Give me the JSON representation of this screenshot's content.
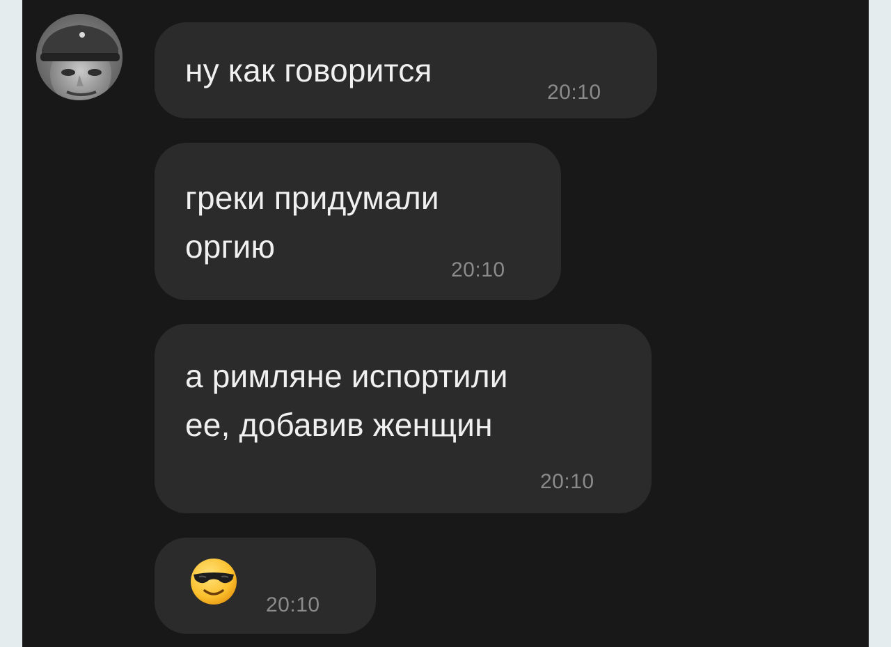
{
  "chat": {
    "messages": [
      {
        "text": "ну как говорится",
        "time": "20:10"
      },
      {
        "text": "греки придумали\nоргию",
        "time": "20:10"
      },
      {
        "text": "а римляне испортили\nее, добавив женщин",
        "time": "20:10"
      },
      {
        "emoji": "smiling-face-with-sunglasses",
        "time": "20:10"
      }
    ]
  },
  "colors": {
    "background": "#181818",
    "bubble": "#2b2b2b",
    "text": "#f0f0f0",
    "timestamp": "#8b8b8b",
    "frame": "#e4ecee"
  }
}
